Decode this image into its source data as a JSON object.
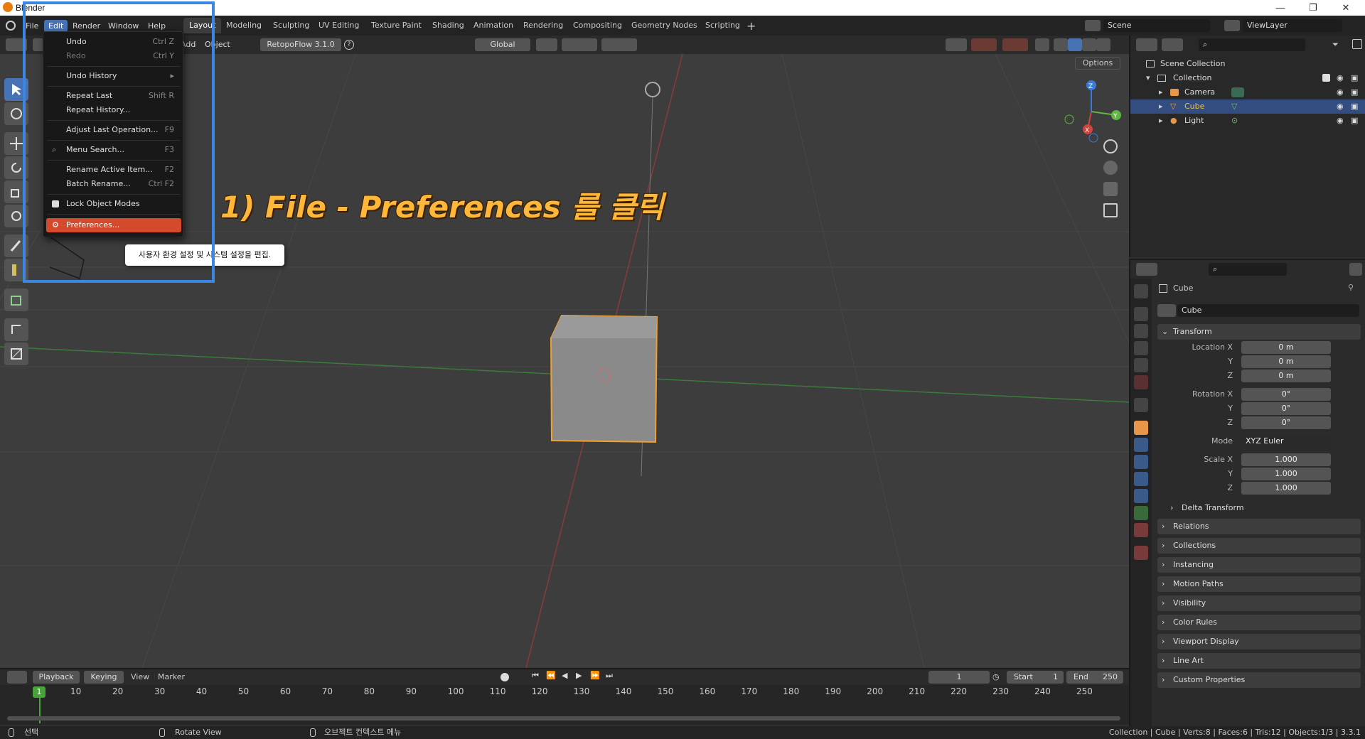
{
  "window": {
    "title": "Blender",
    "min": "—",
    "max": "❐",
    "close": "✕"
  },
  "menubar": [
    "File",
    "Edit",
    "Render",
    "Window",
    "Help"
  ],
  "workspaces": [
    "Layout",
    "Modeling",
    "Sculpting",
    "UV Editing",
    "Texture Paint",
    "Shading",
    "Animation",
    "Rendering",
    "Compositing",
    "Geometry Nodes",
    "Scripting"
  ],
  "scene": {
    "name": "Scene",
    "viewlayer": "ViewLayer"
  },
  "header3d": {
    "add": "Add",
    "object": "Object",
    "addon": "RetopoFlow 3.1.0",
    "orientation": "Global",
    "options": "Options"
  },
  "edit_menu": {
    "undo": "Undo",
    "undo_sc": "Ctrl Z",
    "redo": "Redo",
    "redo_sc": "Ctrl Y",
    "undo_history": "Undo History",
    "repeat_last": "Repeat Last",
    "repeat_last_sc": "Shift R",
    "repeat_history": "Repeat History...",
    "adjust_last": "Adjust Last Operation...",
    "adjust_last_sc": "F9",
    "menu_search": "Menu Search...",
    "menu_search_sc": "F3",
    "rename_active": "Rename Active Item...",
    "rename_active_sc": "F2",
    "batch_rename": "Batch Rename...",
    "batch_rename_sc": "Ctrl F2",
    "lock_object_modes": "Lock Object Modes",
    "preferences": "Preferences..."
  },
  "tooltip": "사용자 환경 설정 및 시스템 설정을 편집.",
  "annotation": "1) File - Preferences 를 클릭",
  "outliner": {
    "scene_collection": "Scene Collection",
    "collection": "Collection",
    "items": [
      {
        "name": "Camera",
        "color": "#ddd"
      },
      {
        "name": "Cube",
        "color": "#f0c040"
      },
      {
        "name": "Light",
        "color": "#ddd"
      }
    ]
  },
  "properties": {
    "object_name": "Cube",
    "data_name": "Cube",
    "transform_title": "Transform",
    "location": {
      "label_x": "Location X",
      "x": "0 m",
      "y": "0 m",
      "z": "0 m"
    },
    "rotation": {
      "label_x": "Rotation X",
      "x": "0°",
      "y": "0°",
      "z": "0°"
    },
    "mode_label": "Mode",
    "mode": "XYZ Euler",
    "scale": {
      "label_x": "Scale X",
      "x": "1.000",
      "y": "1.000",
      "z": "1.000"
    },
    "axis_y": "Y",
    "axis_z": "Z",
    "delta_transform": "Delta Transform",
    "panels": [
      "Relations",
      "Collections",
      "Instancing",
      "Motion Paths",
      "Visibility",
      "Color Rules",
      "Viewport Display",
      "Line Art",
      "Custom Properties"
    ]
  },
  "timeline": {
    "playback": "Playback",
    "keying": "Keying",
    "view": "View",
    "marker": "Marker",
    "current_frame": "1",
    "start_label": "Start",
    "start": "1",
    "end_label": "End",
    "end": "250",
    "ticks": [
      "1",
      "10",
      "20",
      "30",
      "40",
      "50",
      "60",
      "70",
      "80",
      "90",
      "100",
      "110",
      "120",
      "130",
      "140",
      "150",
      "160",
      "170",
      "180",
      "190",
      "200",
      "210",
      "220",
      "230",
      "240",
      "250"
    ]
  },
  "statusbar": {
    "select": "선택",
    "rotate_view": "Rotate View",
    "context_menu": "오브젝트 컨텍스트 메뉴",
    "stats": "Collection | Cube | Verts:8 | Faces:6 | Tris:12 | Objects:1/3 | 3.3.1"
  },
  "colors": {
    "accent": "#4772b3",
    "highlight_menu": "#d44a2c",
    "selection_orange": "#f0a030",
    "annotation_blue": "#3b86e0"
  }
}
